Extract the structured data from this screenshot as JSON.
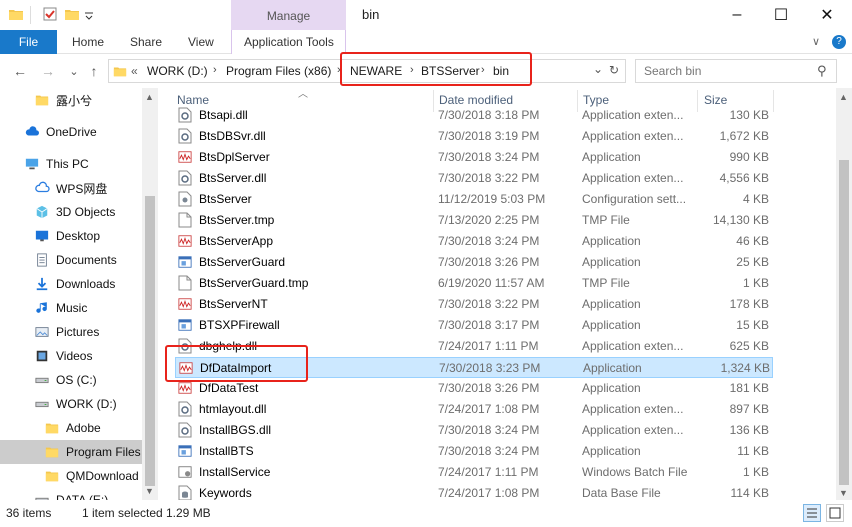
{
  "window": {
    "title": "bin",
    "contextual_tab_group": "Manage",
    "minimize_glyph": "–",
    "maximize_glyph": "☐",
    "close_glyph": "✕"
  },
  "ribbon": {
    "file_tab": "File",
    "tabs": [
      "Home",
      "Share",
      "View",
      "Application Tools"
    ],
    "collapse_glyph": "∨",
    "help_glyph": "?"
  },
  "address": {
    "overflow": "«",
    "crumbs": [
      "WORK (D:)",
      "Program Files (x86)",
      "NEWARE",
      "BTSServer",
      "bin"
    ],
    "search_placeholder": "Search bin",
    "back_glyph": "←",
    "forward_glyph": "→",
    "recent_glyph": "⌄",
    "up_glyph": "↑",
    "dropdown_glyph": "⌄",
    "refresh_glyph": "↻",
    "search_glyph": "⚲",
    "sep": "›"
  },
  "nav": {
    "items": [
      {
        "label": "露小兮",
        "icon": "folder"
      },
      {
        "label": "OneDrive",
        "icon": "cloud"
      },
      {
        "label": "This PC",
        "icon": "pc"
      },
      {
        "label": "WPS网盘",
        "icon": "cloud-outline"
      },
      {
        "label": "3D Objects",
        "icon": "cube"
      },
      {
        "label": "Desktop",
        "icon": "desktop"
      },
      {
        "label": "Documents",
        "icon": "documents"
      },
      {
        "label": "Downloads",
        "icon": "download"
      },
      {
        "label": "Music",
        "icon": "music"
      },
      {
        "label": "Pictures",
        "icon": "pictures"
      },
      {
        "label": "Videos",
        "icon": "videos"
      },
      {
        "label": "OS (C:)",
        "icon": "drive"
      },
      {
        "label": "WORK (D:)",
        "icon": "drive"
      },
      {
        "label": "Adobe",
        "icon": "folder"
      },
      {
        "label": "Program Files (",
        "icon": "folder"
      },
      {
        "label": "QMDownload",
        "icon": "folder"
      },
      {
        "label": "DATA (E:)",
        "icon": "drive"
      }
    ]
  },
  "columns": {
    "name": "Name",
    "date": "Date modified",
    "type": "Type",
    "size": "Size"
  },
  "files": [
    {
      "name": "Btsapi.dll",
      "date": "7/30/2018 3:18 PM",
      "type": "Application exten...",
      "size": "130 KB",
      "icon": "dll"
    },
    {
      "name": "BtsDBSvr.dll",
      "date": "7/30/2018 3:19 PM",
      "type": "Application exten...",
      "size": "1,672 KB",
      "icon": "dll"
    },
    {
      "name": "BtsDplServer",
      "date": "7/30/2018 3:24 PM",
      "type": "Application",
      "size": "990 KB",
      "icon": "app-red"
    },
    {
      "name": "BtsServer.dll",
      "date": "7/30/2018 3:22 PM",
      "type": "Application exten...",
      "size": "4,556 KB",
      "icon": "dll"
    },
    {
      "name": "BtsServer",
      "date": "11/12/2019 5:03 PM",
      "type": "Configuration sett...",
      "size": "4 KB",
      "icon": "config"
    },
    {
      "name": "BtsServer.tmp",
      "date": "7/13/2020 2:25 PM",
      "type": "TMP File",
      "size": "14,130 KB",
      "icon": "file"
    },
    {
      "name": "BtsServerApp",
      "date": "7/30/2018 3:24 PM",
      "type": "Application",
      "size": "46 KB",
      "icon": "app-red"
    },
    {
      "name": "BtsServerGuard",
      "date": "7/30/2018 3:26 PM",
      "type": "Application",
      "size": "25 KB",
      "icon": "app-blue"
    },
    {
      "name": "BtsServerGuard.tmp",
      "date": "6/19/2020 11:57 AM",
      "type": "TMP File",
      "size": "1 KB",
      "icon": "file"
    },
    {
      "name": "BtsServerNT",
      "date": "7/30/2018 3:22 PM",
      "type": "Application",
      "size": "178 KB",
      "icon": "app-red"
    },
    {
      "name": "BTSXPFirewall",
      "date": "7/30/2018 3:17 PM",
      "type": "Application",
      "size": "15 KB",
      "icon": "app-blue"
    },
    {
      "name": "dbghelp.dll",
      "date": "7/24/2017 1:11 PM",
      "type": "Application exten...",
      "size": "625 KB",
      "icon": "dll"
    },
    {
      "name": "DfDataImport",
      "date": "7/30/2018 3:23 PM",
      "type": "Application",
      "size": "1,324 KB",
      "icon": "app-red",
      "selected": true
    },
    {
      "name": "DfDataTest",
      "date": "7/30/2018 3:26 PM",
      "type": "Application",
      "size": "181 KB",
      "icon": "app-red"
    },
    {
      "name": "htmlayout.dll",
      "date": "7/24/2017 1:08 PM",
      "type": "Application exten...",
      "size": "897 KB",
      "icon": "dll"
    },
    {
      "name": "InstallBGS.dll",
      "date": "7/30/2018 3:24 PM",
      "type": "Application exten...",
      "size": "136 KB",
      "icon": "dll"
    },
    {
      "name": "InstallBTS",
      "date": "7/30/2018 3:24 PM",
      "type": "Application",
      "size": "11 KB",
      "icon": "app-blue"
    },
    {
      "name": "InstallService",
      "date": "7/24/2017 1:11 PM",
      "type": "Windows Batch File",
      "size": "1 KB",
      "icon": "batch"
    },
    {
      "name": "Keywords",
      "date": "7/24/2017 1:08 PM",
      "type": "Data Base File",
      "size": "114 KB",
      "icon": "db"
    }
  ],
  "status": {
    "count": "36 items",
    "selection": "1 item selected",
    "size": "1.29 MB"
  },
  "colors": {
    "accent": "#1979ca",
    "selection_bg": "#cce8ff",
    "highlight_red": "#e8231b",
    "context_tab": "#e6d8f2"
  }
}
